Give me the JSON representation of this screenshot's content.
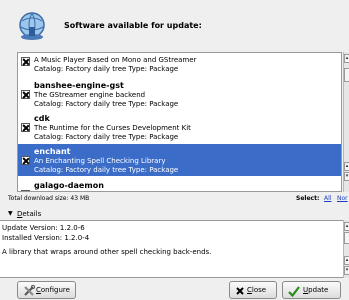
{
  "header": {
    "title": "Software available for update:"
  },
  "packages": [
    {
      "name": "",
      "description": "A Music Player Based on Mono and GStreamer",
      "catalog": "Catalog: Factory daily tree Type: Package",
      "checked": true,
      "selected": false
    },
    {
      "name": "banshee-engine-gst",
      "description": "The GStreamer engine backend",
      "catalog": "Catalog: Factory daily tree Type: Package",
      "checked": true,
      "selected": false
    },
    {
      "name": "cdk",
      "description": "The Runtime for the Curses Development Kit",
      "catalog": "Catalog: Factory daily tree Type: Package",
      "checked": true,
      "selected": false
    },
    {
      "name": "enchant",
      "description": "An Enchanting Spell Checking Library",
      "catalog": "Catalog: Factory daily tree Type: Package",
      "checked": true,
      "selected": true
    },
    {
      "name": "galago-daemon",
      "description": "",
      "catalog": "",
      "checked": false,
      "selected": false
    }
  ],
  "total": "Total download size: 43 MB",
  "select": {
    "label": "Select:",
    "all": "All",
    "none": "Nor"
  },
  "details": {
    "toggle_prefix": "",
    "toggle_mnemonic": "D",
    "toggle_rest": "etails",
    "update_version": "Update Version: 1.2.0-6",
    "installed_version": "Installed Version: 1.2.0-4",
    "description": "A library that wraps around other spell checking back-ends."
  },
  "buttons": {
    "configure": {
      "mnemonic": "C",
      "rest": "onfigure"
    },
    "close": {
      "mnemonic": "C",
      "rest": "lose"
    },
    "update": {
      "mnemonic": "U",
      "rest": "pdate"
    }
  },
  "colors": {
    "selection": "#3a6cc8",
    "link": "#1a3fc0",
    "update_check": "#2a8a1a",
    "close_x": "#000000"
  },
  "icons": {
    "header": "globe-update-icon",
    "arrow": "triangle-down-icon",
    "configure": "wrench-screwdriver-icon",
    "close": "x-icon",
    "update": "checkmark-icon"
  }
}
